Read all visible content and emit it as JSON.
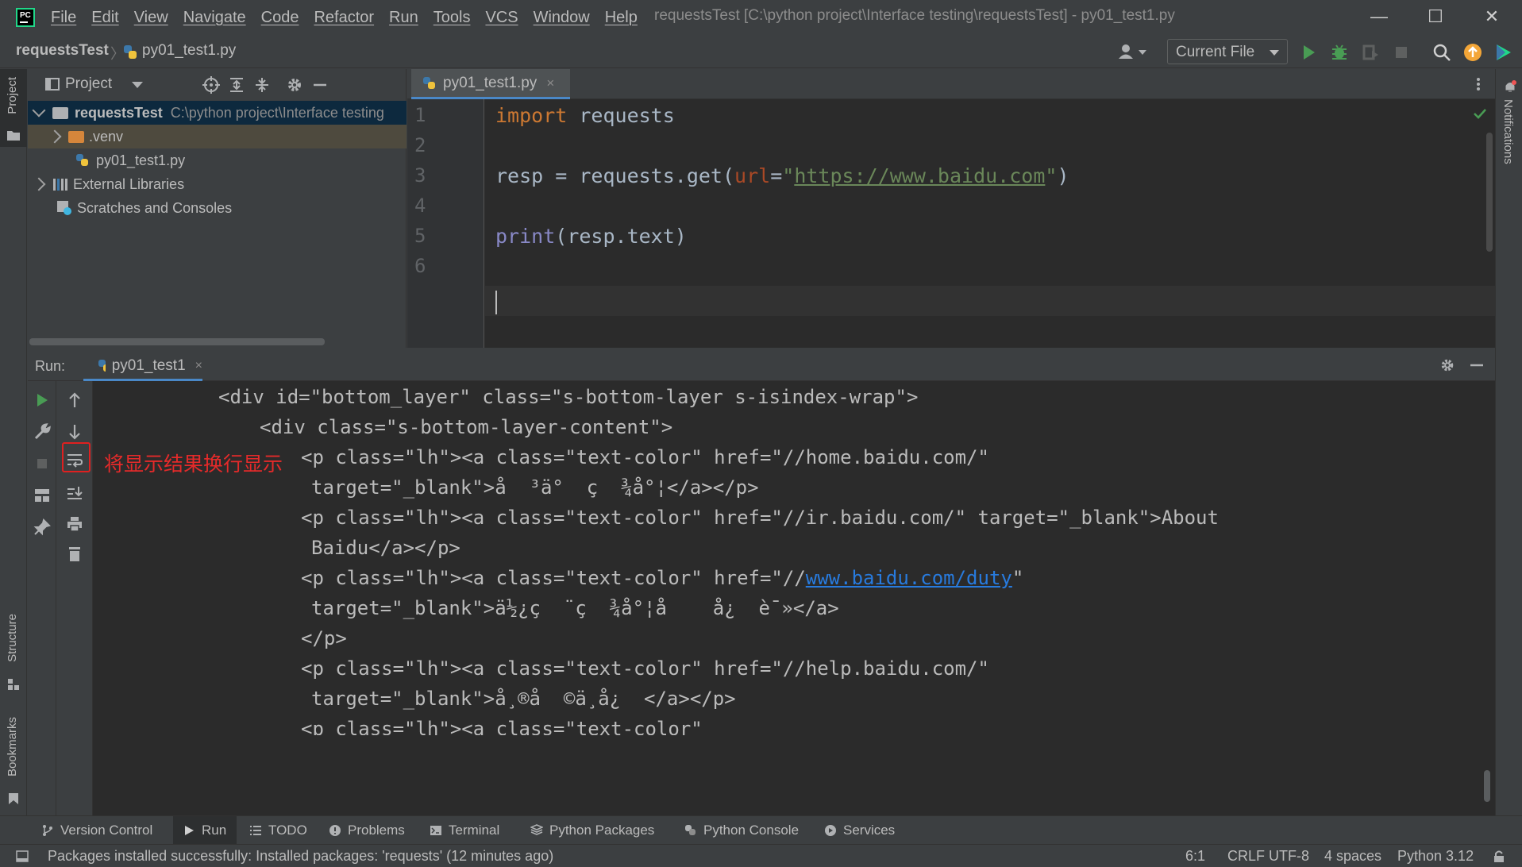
{
  "window": {
    "app_logo": "PC",
    "title": "requestsTest [C:\\python project\\Interface testing\\requestsTest] - py01_test1.py",
    "menu": [
      "File",
      "Edit",
      "View",
      "Navigate",
      "Code",
      "Refactor",
      "Run",
      "Tools",
      "VCS",
      "Window",
      "Help"
    ],
    "controls": {
      "minimize": "—",
      "maximize": "☐",
      "close": "✕"
    }
  },
  "navbar": {
    "project": "requestsTest",
    "separator": "〉",
    "file": "py01_test1.py",
    "run_config": "Current File"
  },
  "left_stripe": {
    "project": "Project",
    "structure": "Structure",
    "bookmarks": "Bookmarks"
  },
  "right_stripe": {
    "notifications": "Notifications"
  },
  "project_panel": {
    "title": "Project",
    "tree": [
      {
        "name": "requestsTest",
        "path": "C:\\python project\\Interface testing"
      },
      {
        "name": ".venv"
      },
      {
        "name": "py01_test1.py"
      },
      {
        "name": "External Libraries"
      },
      {
        "name": "Scratches and Consoles"
      }
    ]
  },
  "editor": {
    "tab": "py01_test1.py",
    "tab_close": "×",
    "line_numbers": [
      "1",
      "2",
      "3",
      "4",
      "5",
      "6"
    ],
    "code": {
      "l1_kw": "import",
      "l1_rest": " requests",
      "l3_a": "resp = requests.get(",
      "l3_param": "url",
      "l3_eq": "=",
      "l3_q1": "\"",
      "l3_url": "https://www.baidu.com",
      "l3_q2": "\"",
      "l3_close": ")",
      "l5_builtin": "print",
      "l5_rest": "(resp.text)"
    }
  },
  "run_panel": {
    "label": "Run:",
    "tab": "py01_test1",
    "tab_close": "×",
    "annotation": "将显示结果换行显示",
    "output": [
      "<div id=\"bottom_layer\" class=\"s-bottom-layer s-isindex-wrap\">",
      "<div class=\"s-bottom-layer-content\">",
      "<p class=\"lh\"><a class=\"text-color\" href=\"//home.baidu.com/\"",
      "target=\"_blank\">å  ³ä°  ç  ¾å°¦</a></p>",
      "<p class=\"lh\"><a class=\"text-color\" href=\"//ir.baidu.com/\" target=\"_blank\">About",
      "Baidu</a></p>",
      "<p class=\"lh\"><a class=\"text-color\" href=\"//",
      "www.baidu.com/duty",
      "\"",
      "target=\"_blank\">ä½¿ç  ¨ç  ¾å°¦å    å¿  è¯»</a>",
      "</p>",
      "<p class=\"lh\"><a class=\"text-color\" href=\"//help.baidu.com/\"",
      "target=\"_blank\">å¸®å  ©ä¸­å¿  </a></p>",
      "<p class=\"lh\"><a class=\"text-color\""
    ]
  },
  "bottom_tabs": [
    "Version Control",
    "Run",
    "TODO",
    "Problems",
    "Terminal",
    "Python Packages",
    "Python Console",
    "Services"
  ],
  "statusbar": {
    "message": "Packages installed successfully: Installed packages: 'requests' (12 minutes ago)",
    "position": "6:1",
    "line_sep": "CRLF",
    "encoding": "UTF-8",
    "indent": "4 spaces",
    "interpreter": "Python 3.12"
  },
  "colors": {
    "accent": "#4a88c7",
    "run_green": "#499c54",
    "annotation_red": "#e52a2a",
    "keyword": "#cc7832",
    "string": "#6a8759"
  }
}
